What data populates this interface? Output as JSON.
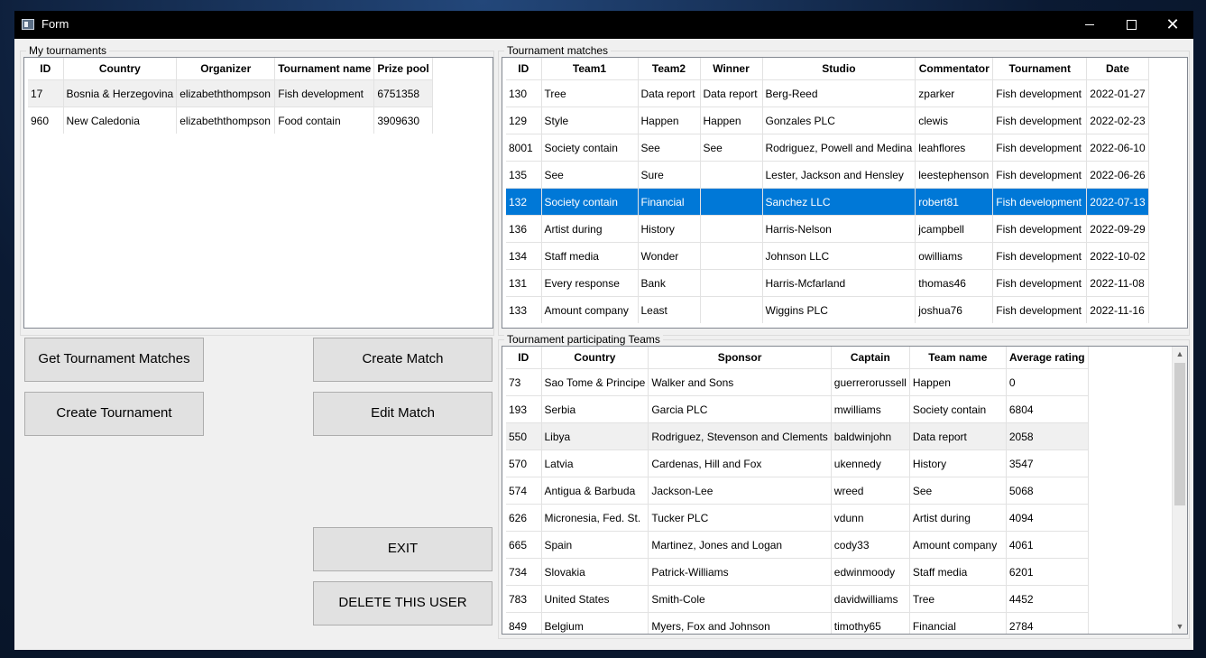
{
  "window": {
    "title": "Form"
  },
  "my_tournaments": {
    "label": "My tournaments",
    "columns": [
      "ID",
      "Country",
      "Organizer",
      "Tournament name",
      "Prize pool"
    ],
    "rows": [
      [
        "17",
        "Bosnia & Herzegovina",
        "elizabeththompson",
        "Fish development",
        "6751358"
      ],
      [
        "960",
        "New Caledonia",
        "elizabeththompson",
        "Food contain",
        "3909630"
      ]
    ]
  },
  "tournament_matches": {
    "label": "Tournament matches",
    "columns": [
      "ID",
      "Team1",
      "Team2",
      "Winner",
      "Studio",
      "Commentator",
      "Tournament",
      "Date"
    ],
    "rows": [
      [
        "130",
        "Tree",
        "Data report",
        "Data report",
        "Berg-Reed",
        "zparker",
        "Fish development",
        "2022-01-27"
      ],
      [
        "129",
        "Style",
        "Happen",
        "Happen",
        "Gonzales PLC",
        "clewis",
        "Fish development",
        "2022-02-23"
      ],
      [
        "8001",
        "Society contain",
        "See",
        "See",
        "Rodriguez, Powell and Medina",
        "leahflores",
        "Fish development",
        "2022-06-10"
      ],
      [
        "135",
        "See",
        "Sure",
        "",
        "Lester, Jackson and Hensley",
        "leestephenson",
        "Fish development",
        "2022-06-26"
      ],
      [
        "132",
        "Society contain",
        "Financial",
        "",
        "Sanchez LLC",
        "robert81",
        "Fish development",
        "2022-07-13"
      ],
      [
        "136",
        "Artist during",
        "History",
        "",
        "Harris-Nelson",
        "jcampbell",
        "Fish development",
        "2022-09-29"
      ],
      [
        "134",
        "Staff media",
        "Wonder",
        "",
        "Johnson LLC",
        "owilliams",
        "Fish development",
        "2022-10-02"
      ],
      [
        "131",
        "Every response",
        "Bank",
        "",
        "Harris-Mcfarland",
        "thomas46",
        "Fish development",
        "2022-11-08"
      ],
      [
        "133",
        "Amount company",
        "Least",
        "",
        "Wiggins PLC",
        "joshua76",
        "Fish development",
        "2022-11-16"
      ]
    ]
  },
  "participating_teams": {
    "label": "Tournament participating Teams",
    "columns": [
      "ID",
      "Country",
      "Sponsor",
      "Captain",
      "Team name",
      "Average rating"
    ],
    "rows": [
      [
        "73",
        "Sao Tome & Principe",
        "Walker and Sons",
        "guerrerorussell",
        "Happen",
        "0"
      ],
      [
        "193",
        "Serbia",
        "Garcia PLC",
        "mwilliams",
        "Society contain",
        "6804"
      ],
      [
        "550",
        "Libya",
        "Rodriguez, Stevenson and Clements",
        "baldwinjohn",
        "Data report",
        "2058"
      ],
      [
        "570",
        "Latvia",
        "Cardenas, Hill and Fox",
        "ukennedy",
        "History",
        "3547"
      ],
      [
        "574",
        "Antigua & Barbuda",
        "Jackson-Lee",
        "wreed",
        "See",
        "5068"
      ],
      [
        "626",
        "Micronesia, Fed. St.",
        "Tucker PLC",
        "vdunn",
        "Artist during",
        "4094"
      ],
      [
        "665",
        "Spain",
        "Martinez, Jones and Logan",
        "cody33",
        "Amount company",
        "4061"
      ],
      [
        "734",
        "Slovakia",
        "Patrick-Williams",
        "edwinmoody",
        "Staff media",
        "6201"
      ],
      [
        "783",
        "United States",
        "Smith-Cole",
        "davidwilliams",
        "Tree",
        "4452"
      ],
      [
        "849",
        "Belgium",
        "Myers, Fox and Johnson",
        "timothy65",
        "Financial",
        "2784"
      ]
    ]
  },
  "buttons": {
    "get_matches": "Get Tournament Matches",
    "create_match": "Create Match",
    "create_tournament": "Create Tournament",
    "edit_match": "Edit Match",
    "exit": "EXIT",
    "delete_user": "DELETE THIS USER"
  },
  "colors": {
    "selection": "#0078d7",
    "titlebar": "#000000",
    "window": "#f0f0f0"
  }
}
